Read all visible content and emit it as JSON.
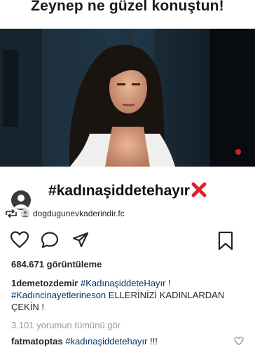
{
  "overlay_caption": "Zeynep ne güzel konuştun!",
  "video": {
    "hashtag_title": "#kadınaşiddetehayır"
  },
  "repost": {
    "username": "dogdugunevkaderindir.fc"
  },
  "post": {
    "views_count": "684.671",
    "views_label": "görüntüleme",
    "caption_username": "1demetozdemir",
    "caption_tag1": "#KadınaşiddeteHayır",
    "caption_text1": " ! ",
    "caption_tag2": "#Kadıncinayetlerineson",
    "caption_text2": " ELLERİNİZİ KADINLARDAN ÇEKİN !",
    "view_all_comments": "3.101 yorumun tümünü gör"
  },
  "comment": {
    "username": "fatmatoptas",
    "tag": "#kadınaşiddetehayır",
    "text": " !!!"
  },
  "colors": {
    "link": "#003569",
    "muted": "#999999",
    "cross": "#e0202a"
  },
  "icons": [
    "heart-icon",
    "comment-icon",
    "share-icon",
    "bookmark-icon",
    "repost-icon",
    "cross-icon",
    "avatar"
  ]
}
